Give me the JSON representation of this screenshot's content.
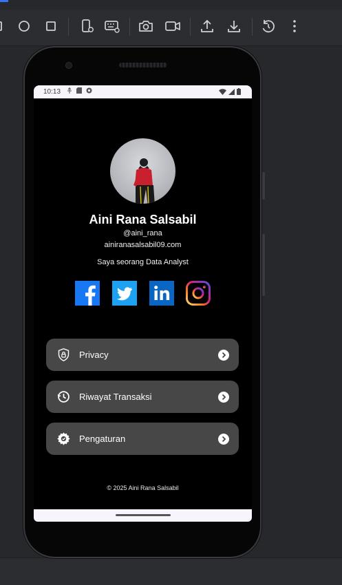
{
  "toolbar": {
    "icons": [
      "circle-icon",
      "square-icon",
      "device-settings-icon",
      "keyboard-settings-icon",
      "camera-icon",
      "video-icon",
      "upload-icon",
      "download-icon",
      "rotate-icon",
      "more-vertical-icon"
    ]
  },
  "status_bar": {
    "time": "10:13"
  },
  "profile": {
    "name": "Aini Rana Salsabil",
    "handle": "@aini_rana",
    "email": "ainiranasalsabil09.com",
    "bio": "Saya seorang Data Analyst"
  },
  "social": [
    "facebook-icon",
    "twitter-icon",
    "linkedin-icon",
    "instagram-icon"
  ],
  "menu": [
    {
      "label": "Privacy",
      "icon": "shield-lock-icon"
    },
    {
      "label": "Riwayat Transaksi",
      "icon": "history-icon"
    },
    {
      "label": "Pengaturan",
      "icon": "gear-icon"
    }
  ],
  "footer": "© 2025 Aini Rana Salsabil",
  "colors": {
    "ide_background": "#27282c",
    "screen_background": "#000000",
    "menu_button": "#474747",
    "facebook": "#1877f2",
    "twitter": "#1da1f2",
    "linkedin": "#0a66c2"
  }
}
